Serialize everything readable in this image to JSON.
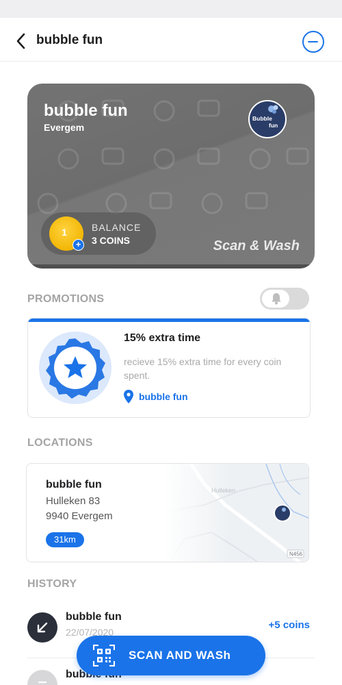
{
  "header": {
    "title": "bubble fun",
    "back_icon": "chevron-left-icon",
    "action_icon": "minus-circle-icon"
  },
  "card": {
    "name": "bubble fun",
    "city": "Evergem",
    "logo_text_top": "Bubble",
    "logo_text_bottom": "fun",
    "coin_number": "1",
    "balance_label": "BALANCE",
    "balance_value": "3 COINS",
    "tagline": "Scan & Wash"
  },
  "promotions": {
    "section_label": "PROMOTIONS",
    "toggle_icon": "bell-icon",
    "toggle_on": false,
    "items": [
      {
        "title": "15% extra time",
        "description": "recieve 15% extra time for every coin spent.",
        "location": "bubble fun",
        "badge_icon": "star-badge-icon"
      }
    ]
  },
  "locations": {
    "section_label": "LOCATIONS",
    "items": [
      {
        "name": "bubble fun",
        "street": "Hulleken 83",
        "city": "9940 Evergem",
        "distance": "31km",
        "map_label": "Hulleken",
        "road_label": "N456"
      }
    ]
  },
  "history": {
    "section_label": "HISTORY",
    "items": [
      {
        "name": "bubble fun",
        "date": "22/07/2020",
        "coins": "+5 coins",
        "icon": "arrow-down-left-icon"
      },
      {
        "name": "bubble fun",
        "date": "",
        "coins": "",
        "icon": "menu-icon"
      }
    ]
  },
  "scan_button": {
    "label": "SCAN AND WASh",
    "icon": "qr-code-icon"
  },
  "colors": {
    "accent": "#1a73e8",
    "card_gray": "#737373",
    "coin_gold": "#f2b705"
  }
}
